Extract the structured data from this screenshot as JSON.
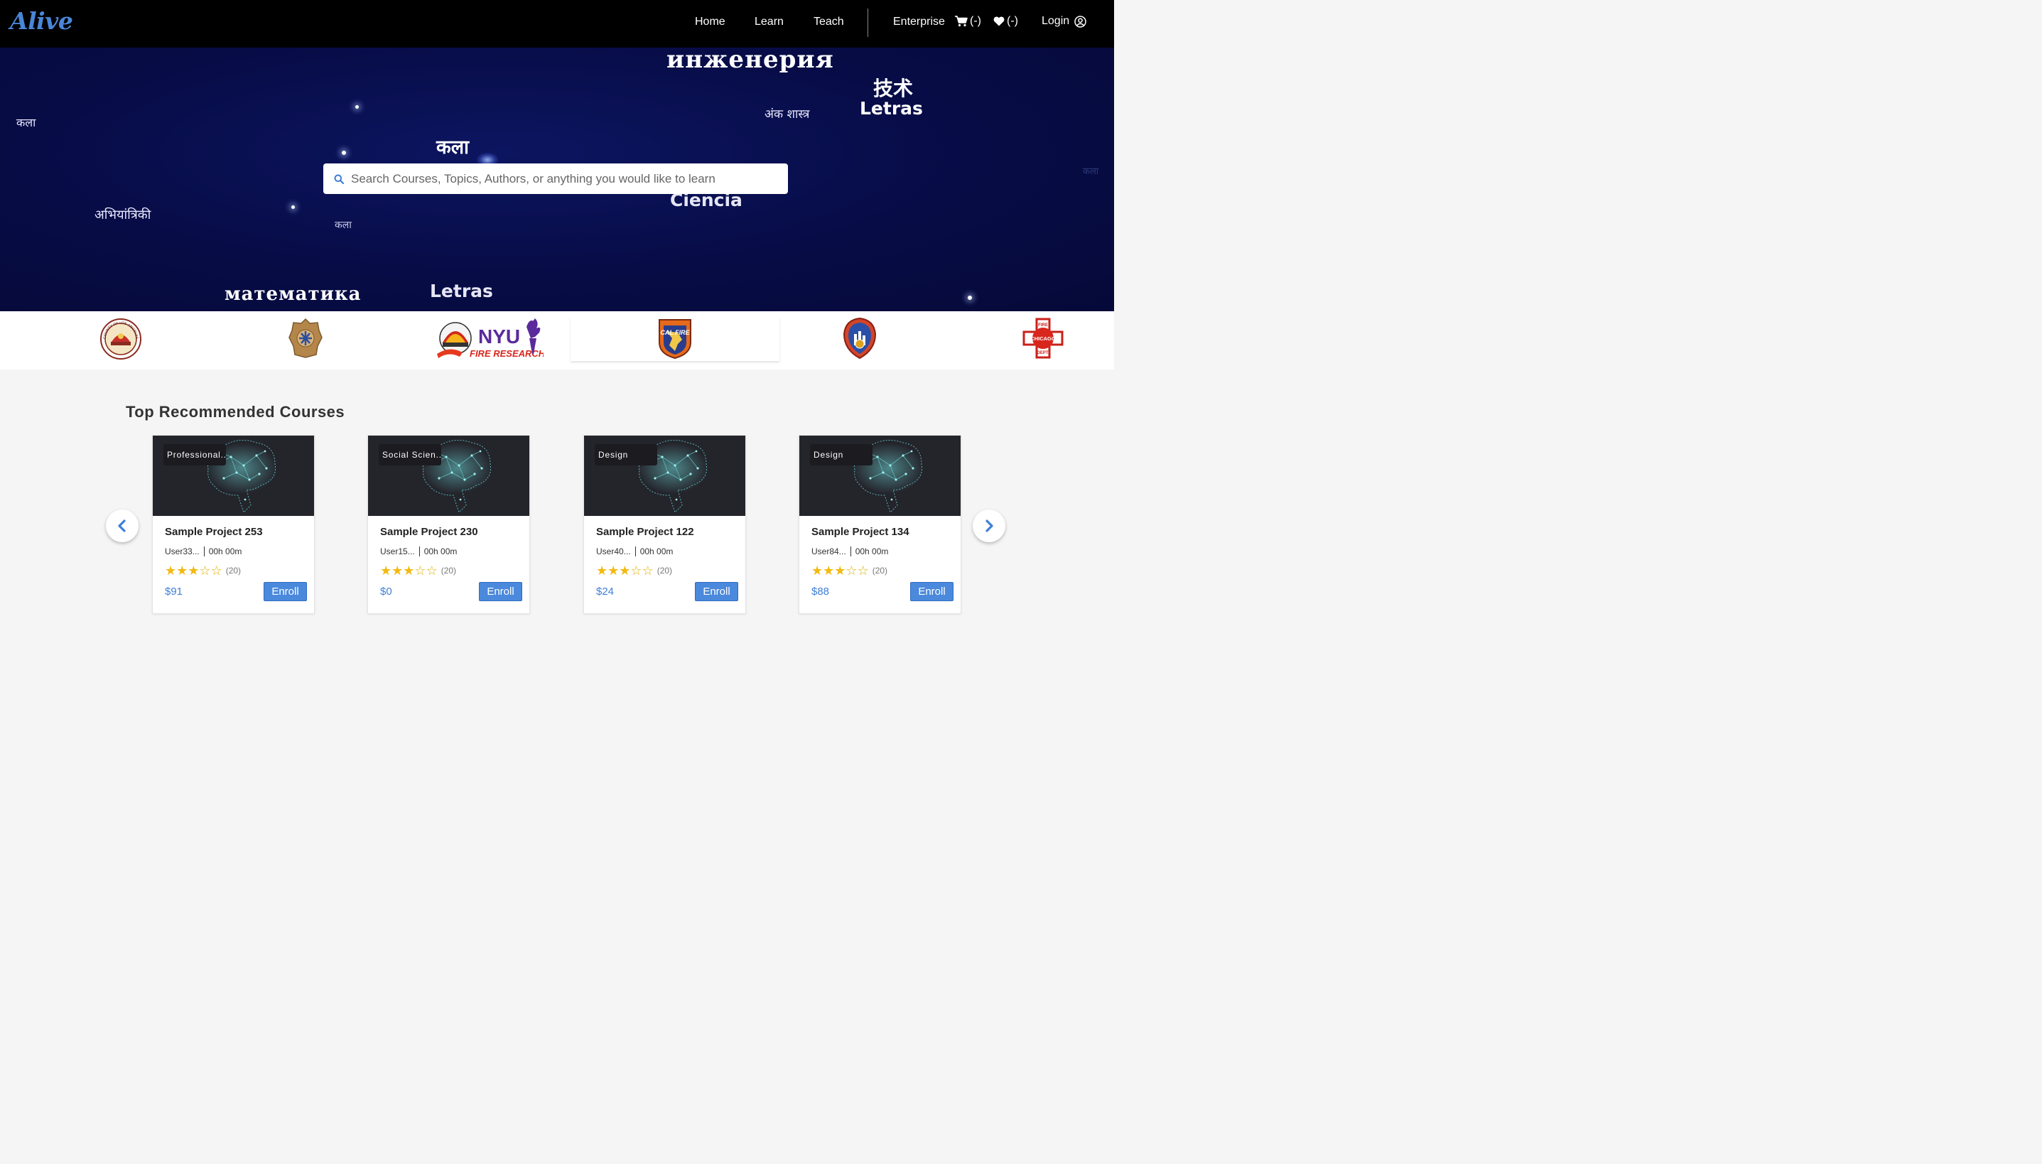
{
  "nav": {
    "logo": "Alive",
    "links": [
      "Home",
      "Learn",
      "Teach",
      "Enterprise"
    ],
    "cart_count": "(-)",
    "wishlist_count": "(-)",
    "login": "Login"
  },
  "hero": {
    "words": [
      "инженерия",
      "技术",
      "Letras",
      "अंक शास्त्र",
      "कला",
      "कला",
      "Ciencia",
      "अभियांत्रिकी",
      "कला",
      "математика",
      "Letras",
      "कला"
    ],
    "search_placeholder": "Search Courses, Topics, Authors, or anything you would like to learn"
  },
  "partners": [
    {
      "icon": "la-county-fire-logo",
      "text": "COUNTY OF LOS ANGELES FIRE DEPARTMENT"
    },
    {
      "icon": "ems-badge-logo",
      "text": ""
    },
    {
      "icon": "nyu-fire-research-logo",
      "text": "NYU",
      "subtext": "FIRE RESEARCH"
    },
    {
      "icon": "cal-fire-logo",
      "text": "CAL FIRE"
    },
    {
      "icon": "fdny-logo",
      "text": ""
    },
    {
      "icon": "chicago-fire-dept-logo",
      "text": "CHICAGO",
      "top": "FIRE",
      "bottom": "DEPT."
    }
  ],
  "section_title": "Top Recommended Courses",
  "courses": [
    {
      "category": "Professional...",
      "title": "Sample Project 253",
      "author": "User33...",
      "duration": "00h 00m",
      "rating": 3,
      "reviews": "(20)",
      "price": "$91",
      "cta": "Enroll"
    },
    {
      "category": "Social Scien...",
      "title": "Sample Project 230",
      "author": "User15...",
      "duration": "00h 00m",
      "rating": 3,
      "reviews": "(20)",
      "price": "$0",
      "cta": "Enroll"
    },
    {
      "category": "Design",
      "title": "Sample Project 122",
      "author": "User40...",
      "duration": "00h 00m",
      "rating": 3,
      "reviews": "(20)",
      "price": "$24",
      "cta": "Enroll"
    },
    {
      "category": "Design",
      "title": "Sample Project 134",
      "author": "User84...",
      "duration": "00h 00m",
      "rating": 3,
      "reviews": "(20)",
      "price": "$88",
      "cta": "Enroll"
    }
  ],
  "colors": {
    "accent": "#4a89dc",
    "hero": "#070c46",
    "star": "#f2b90f"
  }
}
